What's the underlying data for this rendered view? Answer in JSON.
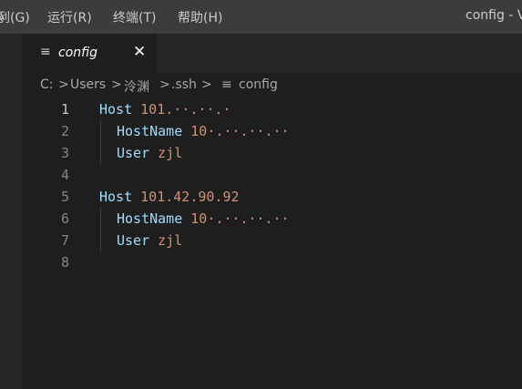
{
  "menubar": {
    "items": [
      "剢(G)",
      "运行(R)",
      "终端(T)",
      "帮助(H)"
    ],
    "window_title": "config - V"
  },
  "tab": {
    "label": "config",
    "close_glyph": "✕",
    "icon": "lines-file-icon"
  },
  "breadcrumb": {
    "items": [
      "C:",
      "Users",
      "泠渊",
      ".ssh",
      "config"
    ],
    "separator": ">"
  },
  "editor": {
    "line_numbers": [
      "1",
      "2",
      "3",
      "4",
      "5",
      "6",
      "7",
      "8"
    ],
    "active_line": 1,
    "lines": [
      {
        "keyword": "Host",
        "value": "101.··.··.·"
      },
      {
        "keyword": "HostName",
        "value": "10·.··.··.··"
      },
      {
        "keyword": "User",
        "value": "zjl"
      },
      {
        "keyword": "",
        "value": ""
      },
      {
        "keyword": "Host",
        "value": "101.42.90.92"
      },
      {
        "keyword": "HostName",
        "value": "10·.··.··.··"
      },
      {
        "keyword": "User",
        "value": "zjl"
      },
      {
        "keyword": "",
        "value": ""
      }
    ]
  },
  "colors": {
    "keyword": "#9cdcfe",
    "value": "#ce9178",
    "background": "#1e1e1e"
  }
}
